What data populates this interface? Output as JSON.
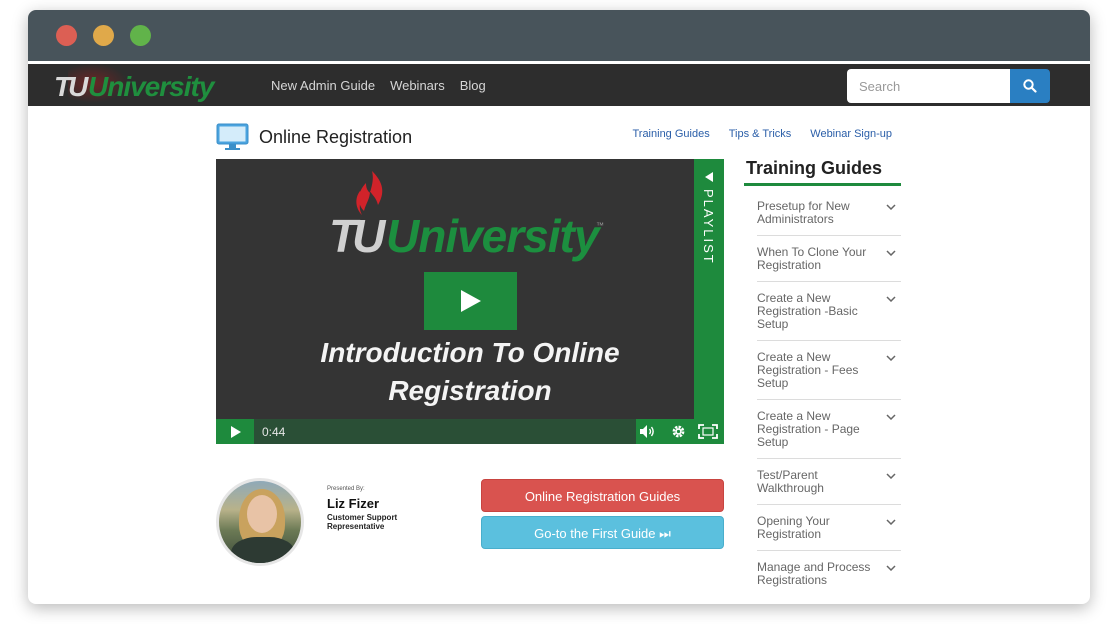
{
  "nav": {
    "brand_tu": "TU",
    "brand_university": "University",
    "links": [
      "New Admin Guide",
      "Webinars",
      "Blog"
    ],
    "search_placeholder": "Search"
  },
  "page": {
    "title": "Online Registration",
    "sublinks": [
      "Training Guides",
      "Tips & Tricks",
      "Webinar Sign-up"
    ]
  },
  "video": {
    "brand_tu": "TU",
    "brand_university": "University",
    "trademark": "™",
    "title_line1": "Introduction To Online",
    "title_line2": "Registration",
    "playlist_label": "PLAYLIST",
    "time": "0:44"
  },
  "presenter": {
    "presented_by": "Presented By:",
    "name": "Liz Fizer",
    "role": "Customer Support Representative"
  },
  "buttons": {
    "guides": "Online Registration Guides",
    "first_guide": "Go-to the First Guide ⏭"
  },
  "sidebar": {
    "title": "Training Guides",
    "items": [
      "Presetup for New Administrators",
      "When To Clone Your Registration",
      "Create a New Registration -Basic Setup",
      "Create a New Registration - Fees Setup",
      "Create a New Registration - Page Setup",
      "Test/Parent Walkthrough",
      "Opening Your Registration",
      "Manage and Process Registrations"
    ]
  },
  "colors": {
    "nav_bg": "#2d2d2d",
    "brand_green": "#1e8a3d",
    "search_button": "#2a7fc2",
    "button_red": "#d9534f",
    "button_blue": "#5bc0de"
  }
}
